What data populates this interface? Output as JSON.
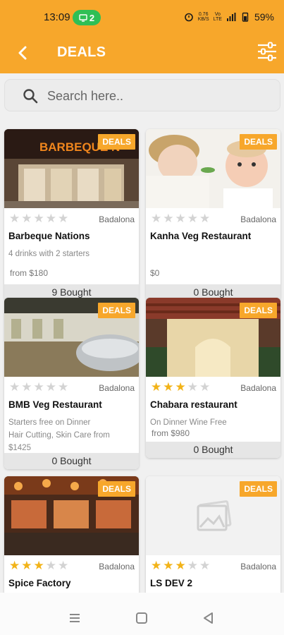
{
  "status": {
    "time": "13:09",
    "notif_count": "2",
    "net_speed_top": "0.76",
    "net_speed_bottom": "KB/S",
    "vo_top": "Vo",
    "vo_bottom": "LTE",
    "battery": "59%"
  },
  "appbar": {
    "title": "DEALS"
  },
  "search": {
    "placeholder": "Search here.."
  },
  "colors": {
    "accent": "#f7a72b",
    "star_on": "#f2b318",
    "star_off": "#d3d3d3"
  },
  "deals": [
    {
      "badge": "DEALS",
      "location": "Badalona",
      "rating": 0,
      "name": "Barbeque Nations",
      "desc": "4 drinks with 2 starters",
      "price": "from $180",
      "bought": "9 Bought",
      "image_sign": "BARBEQUE N"
    },
    {
      "badge": "DEALS",
      "location": "Badalona",
      "rating": 0,
      "name": "Kanha Veg Restaurant",
      "desc": "",
      "price": "$0",
      "bought": "0 Bought"
    },
    {
      "badge": "DEALS",
      "location": "Badalona",
      "rating": 0,
      "name": "BMB Veg Restaurant",
      "desc": "Starters free on Dinner",
      "desc2": "Hair Cutting, Skin Care from $1425",
      "price": "",
      "bought": "0 Bought"
    },
    {
      "badge": "DEALS",
      "location": "Badalona",
      "rating": 3,
      "name": "Chabara restaurant",
      "desc": "On Dinner Wine Free",
      "price": "from $980",
      "bought": "0 Bought"
    },
    {
      "badge": "DEALS",
      "location": "Badalona",
      "rating": 3,
      "name": "Spice Factory"
    },
    {
      "badge": "DEALS",
      "location": "Badalona",
      "rating": 3,
      "name": "LS DEV 2"
    }
  ]
}
